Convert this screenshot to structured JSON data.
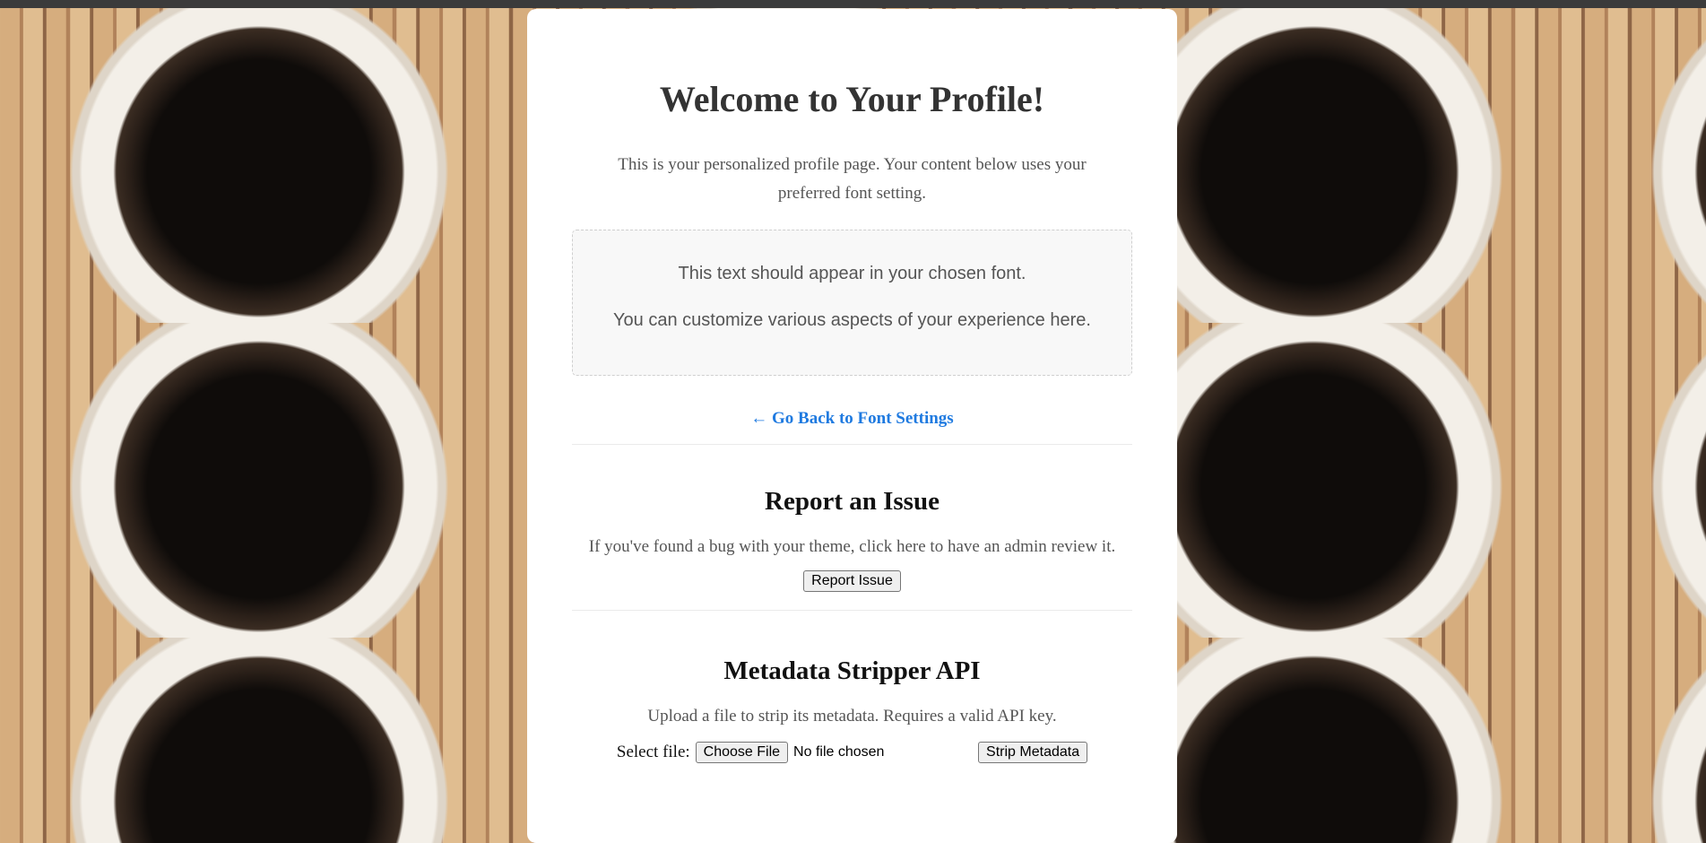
{
  "page": {
    "title": "Welcome to Your Profile!",
    "intro": "This is your personalized profile page. Your content below uses your preferred font setting.",
    "custom_box": {
      "line1": "This text should appear in your chosen font.",
      "line2": "You can customize various aspects of your experience here."
    },
    "back_link": "← Go Back to Font Settings"
  },
  "report": {
    "heading": "Report an Issue",
    "text": "If you've found a bug with your theme, click here to have an admin review it.",
    "button": "Report Issue"
  },
  "metadata": {
    "heading": "Metadata Stripper API",
    "text": "Upload a file to strip its metadata. Requires a valid API key.",
    "select_label": "Select file:",
    "choose_button": "Choose File",
    "file_status": "No file chosen",
    "strip_button": "Strip Metadata"
  },
  "colors": {
    "link": "#1f7ae0",
    "panel_bg": "#ffffff"
  }
}
